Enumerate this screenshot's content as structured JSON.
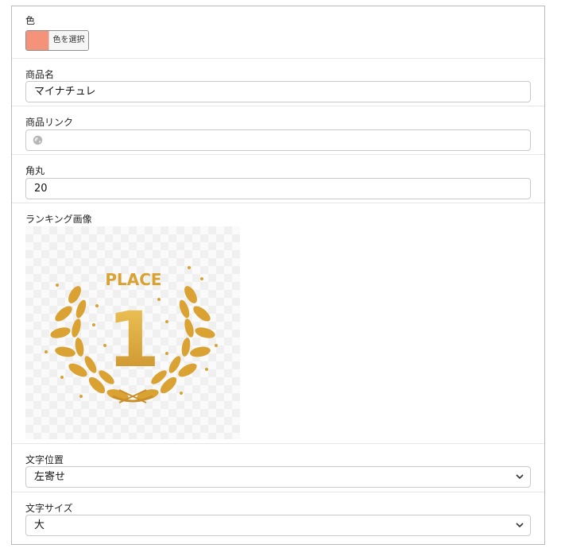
{
  "fields": {
    "color": {
      "label": "色",
      "swatch_color": "#F4937A",
      "button_label": "色を選択"
    },
    "product_name": {
      "label": "商品名",
      "value": "マイナチュレ"
    },
    "product_link": {
      "label": "商品リンク",
      "value": "",
      "icon": "globe-icon"
    },
    "corner_radius": {
      "label": "角丸",
      "value": "20"
    },
    "ranking_image": {
      "label": "ランキング画像",
      "badge_text": "PLACE",
      "badge_number": "1",
      "colors": {
        "gold": "#D9A233",
        "gold_light": "#F0C75A"
      }
    },
    "text_position": {
      "label": "文字位置",
      "value": "左寄せ"
    },
    "text_size": {
      "label": "文字サイズ",
      "value": "大"
    }
  }
}
